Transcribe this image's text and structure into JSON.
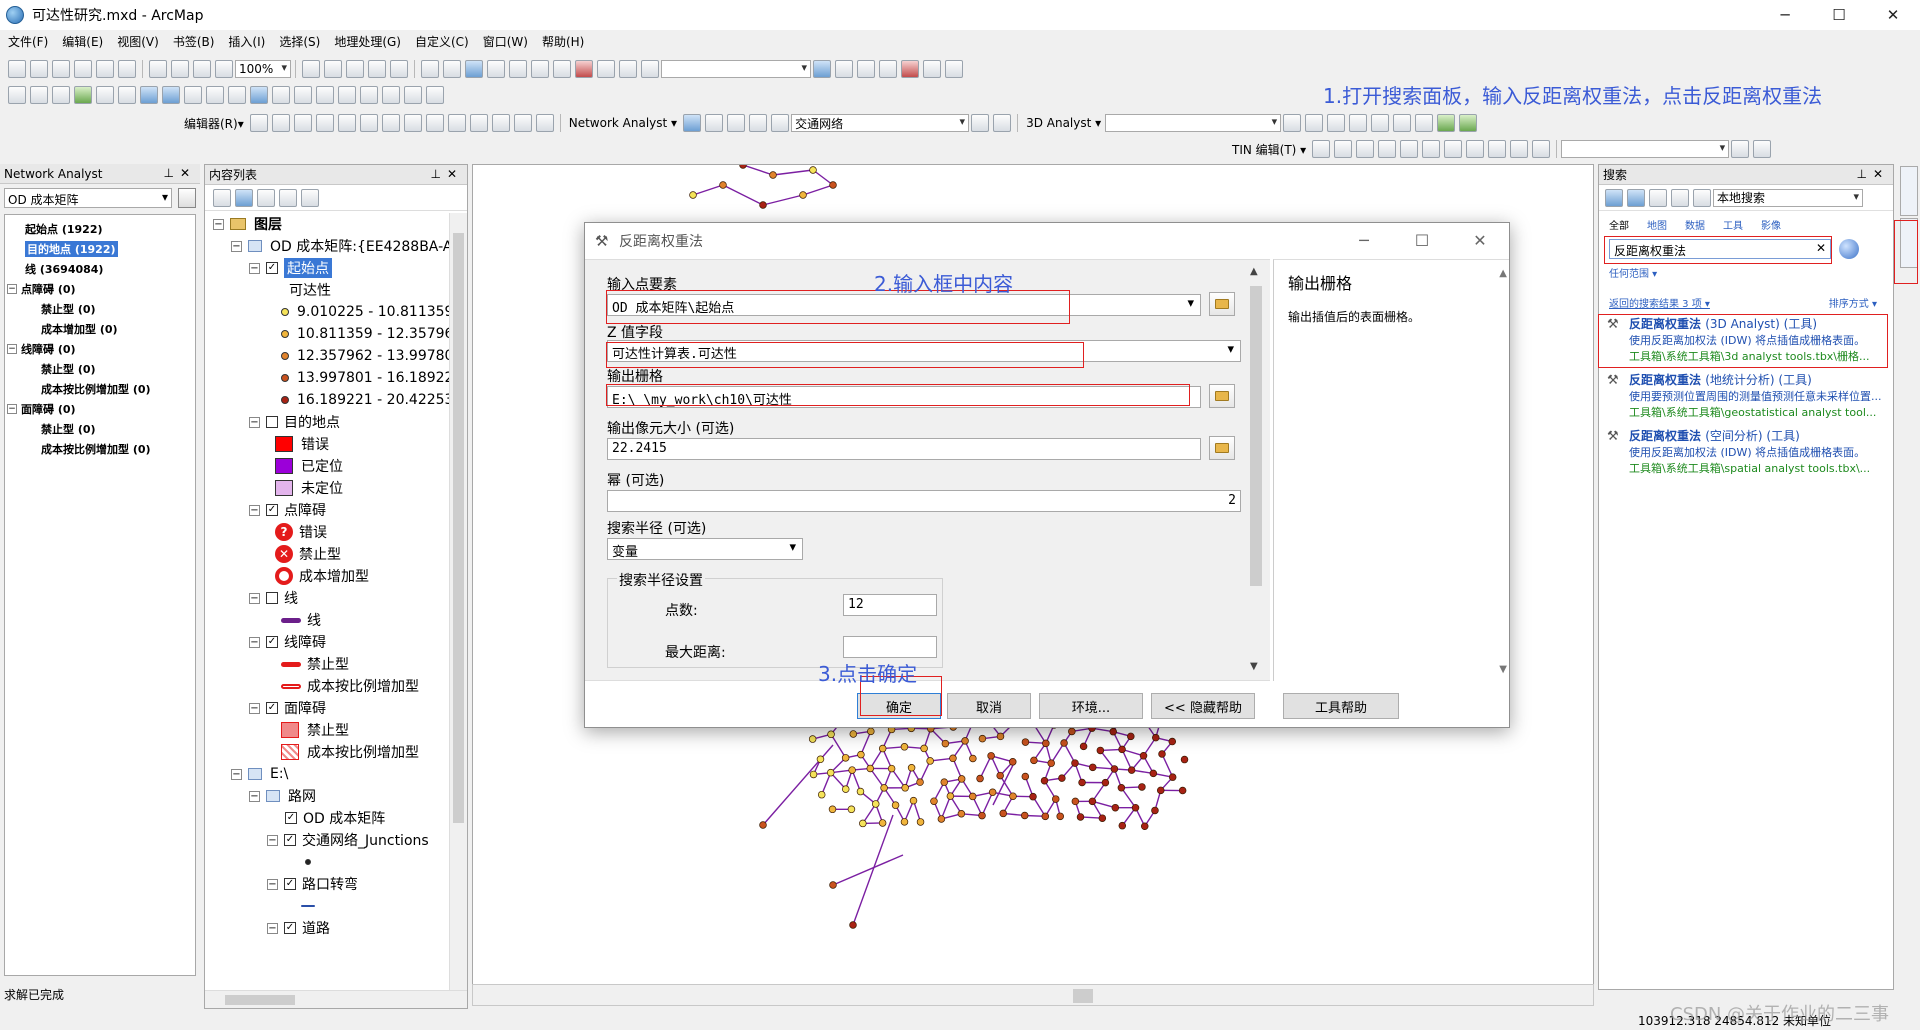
{
  "window": {
    "title": "可达性研究.mxd - ArcMap",
    "minimize": "─",
    "maximize": "☐",
    "close": "✕"
  },
  "menu": [
    "文件(F)",
    "编辑(E)",
    "视图(V)",
    "书签(B)",
    "插入(I)",
    "选择(S)",
    "地理处理(G)",
    "自定义(C)",
    "窗口(W)",
    "帮助(H)"
  ],
  "toolbar": {
    "zoom": "100%",
    "editor_label": "编辑器(R)▾",
    "network_analyst_label": "Network Analyst ▾",
    "network_dataset": "交通网络",
    "analyst3d_label": "3D Analyst ▾",
    "tin_label": "TIN 编辑(T) ▾"
  },
  "annotations": {
    "step1": "1.打开搜索面板，输入反距离权重法，点击反距离权重法",
    "step2": "2.输入框中内容",
    "step3": "3.点击确定"
  },
  "network_analyst": {
    "header": "Network Analyst",
    "layer": "OD 成本矩阵",
    "items": [
      {
        "label": "起始点 (1922)",
        "expander": "",
        "indent": 0,
        "selected": false
      },
      {
        "label": "目的地点 (1922)",
        "expander": "",
        "indent": 0,
        "selected": true
      },
      {
        "label": "线 (3694084)",
        "expander": "",
        "indent": 0,
        "selected": false
      },
      {
        "label": "点障碍 (0)",
        "expander": "−",
        "indent": 0,
        "selected": false
      },
      {
        "label": "禁止型 (0)",
        "expander": "",
        "indent": 1,
        "selected": false
      },
      {
        "label": "成本增加型 (0)",
        "expander": "",
        "indent": 1,
        "selected": false
      },
      {
        "label": "线障碍 (0)",
        "expander": "−",
        "indent": 0,
        "selected": false
      },
      {
        "label": "禁止型 (0)",
        "expander": "",
        "indent": 1,
        "selected": false
      },
      {
        "label": "成本按比例增加型 (0)",
        "expander": "",
        "indent": 1,
        "selected": false
      },
      {
        "label": "面障碍 (0)",
        "expander": "−",
        "indent": 0,
        "selected": false
      },
      {
        "label": "禁止型 (0)",
        "expander": "",
        "indent": 1,
        "selected": false
      },
      {
        "label": "成本按比例增加型 (0)",
        "expander": "",
        "indent": 1,
        "selected": false
      }
    ],
    "status": "求解已完成"
  },
  "toc": {
    "header": "内容列表",
    "layers_label": "图层",
    "od_group": "OD 成本矩阵:{EE4288BA-A",
    "origins_label": "起始点",
    "field_label": "可达性",
    "classes": [
      {
        "label": "9.010225 - 10.811359",
        "color": "#f5e35a"
      },
      {
        "label": "10.811359 - 12.357962",
        "color": "#f0b53c"
      },
      {
        "label": "12.357962 - 13.997801",
        "color": "#e0832c"
      },
      {
        "label": "13.997801 - 16.189221",
        "color": "#c8521e"
      },
      {
        "label": "16.189221 - 20.42253",
        "color": "#a82214"
      }
    ],
    "destinations_label": "目的地点",
    "dest_error": "错误",
    "dest_located": "已定位",
    "dest_unlocated": "未定位",
    "point_barriers": "点障碍",
    "pb_error": "错误",
    "pb_restrict": "禁止型",
    "pb_cost": "成本增加型",
    "lines_label": "线",
    "line_sym": "线",
    "line_barriers": "线障碍",
    "lb_restrict": "禁止型",
    "lb_cost": "成本按比例增加型",
    "poly_barriers": "面障碍",
    "polyb_restrict": "禁止型",
    "polyb_cost": "成本按比例增加型",
    "e_group": "E:\\",
    "road_network": "路网",
    "od_matrix": "OD 成本矩阵",
    "junctions": "交通网络_Junctions",
    "turns": "路口转弯",
    "roads": "道路"
  },
  "dialog": {
    "title": "反距离权重法",
    "input_points_label": "输入点要素",
    "input_points_value": "OD 成本矩阵\\起始点",
    "z_field_label": "Z 值字段",
    "z_field_value": "可达性计算表.可达性",
    "output_raster_label": "输出栅格",
    "output_raster_value": "E:\\          \\my_work\\ch10\\可达性",
    "cell_size_label": "输出像元大小 (可选)",
    "cell_size_value": "22.2415",
    "power_label": "幂 (可选)",
    "power_value": "2",
    "search_radius_label": "搜索半径 (可选)",
    "search_radius_value": "变量",
    "radius_settings_label": "搜索半径设置",
    "points_label": "点数:",
    "points_value": "12",
    "max_dist_label": "最大距离:",
    "max_dist_value": "",
    "help_title": "输出栅格",
    "help_desc": "输出插值后的表面栅格。",
    "buttons": {
      "ok": "确定",
      "cancel": "取消",
      "env": "环境...",
      "hide_help": "<< 隐藏帮助",
      "tool_help": "工具帮助"
    }
  },
  "search": {
    "header": "搜索",
    "scope": "本地搜索",
    "tabs": [
      "全部",
      "地图",
      "数据",
      "工具",
      "影像"
    ],
    "query": "反距离权重法",
    "any_extent": "任何范围 ▾",
    "suggestions": "返回的搜索结果 3 项 ▾",
    "sort": "排序方式 ▾",
    "results": [
      {
        "title": "反距离权重法",
        "source": "(3D Analyst) (工具)",
        "desc": "使用反距离加权法 (IDW) 将点插值成栅格表面。",
        "path": "工具箱\\系统工具箱\\3d analyst tools.tbx\\栅格..."
      },
      {
        "title": "反距离权重法",
        "source": "(地统计分析) (工具)",
        "desc": "使用要预测位置周围的测量值预测任意未采样位置...",
        "path": "工具箱\\系统工具箱\\geostatistical analyst tool..."
      },
      {
        "title": "反距离权重法",
        "source": "(空间分析) (工具)",
        "desc": "使用反距离加权法 (IDW) 将点插值成栅格表面。",
        "path": "工具箱\\系统工具箱\\spatial analyst tools.tbx\\..."
      }
    ]
  },
  "status": {
    "coords": "103912.318  24854.812 未知单位"
  },
  "watermark": "CSDN @关于作业的二三事"
}
